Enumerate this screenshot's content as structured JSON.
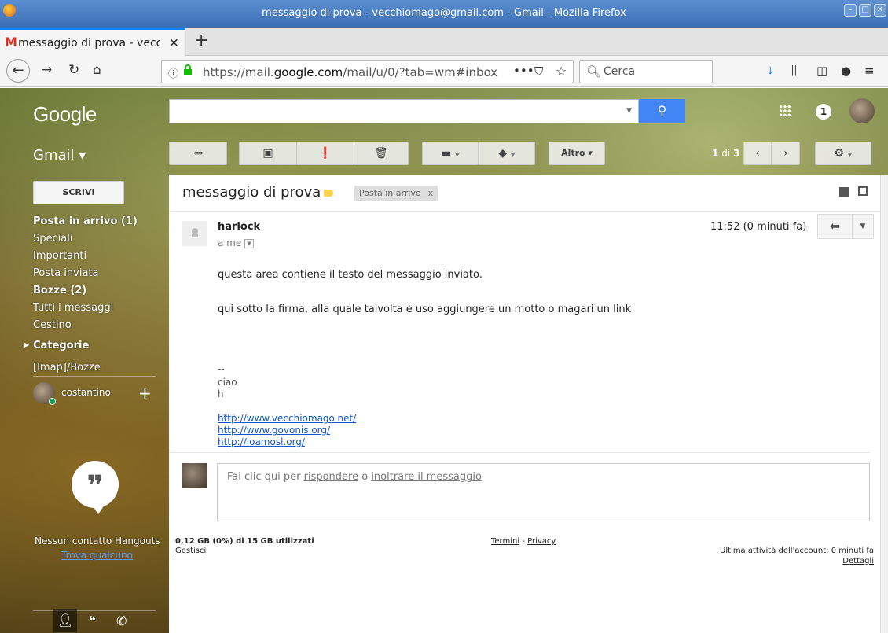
{
  "window": {
    "title": "messaggio di prova - vecchiomago@gmail.com - Gmail - Mozilla Firefox"
  },
  "tab": {
    "label": "messaggio di prova - vecchiomago@gmail.com",
    "close": "✕",
    "new_tab": "+"
  },
  "navbar": {
    "url_prefix": "https://mail.",
    "url_domain": "google.com",
    "url_rest": "/mail/u/0/?tab=wm#inbox",
    "search_placeholder": "Cerca",
    "page_actions": "•••"
  },
  "gmail": {
    "logo": "Google",
    "product": "Gmail ▾",
    "notifications_count": "1",
    "toolbar": {
      "more_label": "Altro ▾"
    },
    "pager": {
      "current": "1",
      "of_label": "di",
      "total": "3"
    }
  },
  "sidebar": {
    "compose": "SCRIVI",
    "items": [
      {
        "label": "Posta in arrivo (1)",
        "bold": true
      },
      {
        "label": "Speciali",
        "bold": false
      },
      {
        "label": "Importanti",
        "bold": false
      },
      {
        "label": "Posta inviata",
        "bold": false
      },
      {
        "label": "Bozze (2)",
        "bold": true
      },
      {
        "label": "Tutti i messaggi",
        "bold": false
      },
      {
        "label": "Cestino",
        "bold": false
      }
    ],
    "categories": "Categorie",
    "imap_label": "[Imap]/Bozze",
    "hangouts_user": "costantino",
    "no_contacts": "Nessun contatto Hangouts",
    "find_someone": "Trova qualcuno"
  },
  "message": {
    "subject": "messaggio di prova",
    "folder_chip": "Posta in arrivo",
    "folder_chip_close": "x",
    "sender": "harlock",
    "to": "a me",
    "time": "11:52 (0 minuti fa)",
    "body_line1": "questa area contiene il testo del messaggio inviato.",
    "body_line2": "qui sotto la firma, alla quale talvolta è uso aggiungere un motto o magari un link",
    "ellipsis": "···",
    "sig_dashes": "--",
    "sig_line1": "ciao",
    "sig_line2": "h",
    "links": [
      "http://www.vecchiomago.net/",
      "http://www.govonis.org/",
      "http://ioamosl.org/"
    ]
  },
  "reply_box": {
    "prefix": "Fai clic qui per ",
    "reply": "rispondere",
    "middle": " o ",
    "forward": "inoltrare il messaggio"
  },
  "footer": {
    "storage": "0,12 GB (0%) di 15 GB utilizzati",
    "manage": "Gestisci",
    "terms": "Termini",
    "sep": " - ",
    "privacy": "Privacy",
    "last_activity": "Ultima attività dell'account: 0 minuti fa",
    "details": "Dettagli"
  }
}
